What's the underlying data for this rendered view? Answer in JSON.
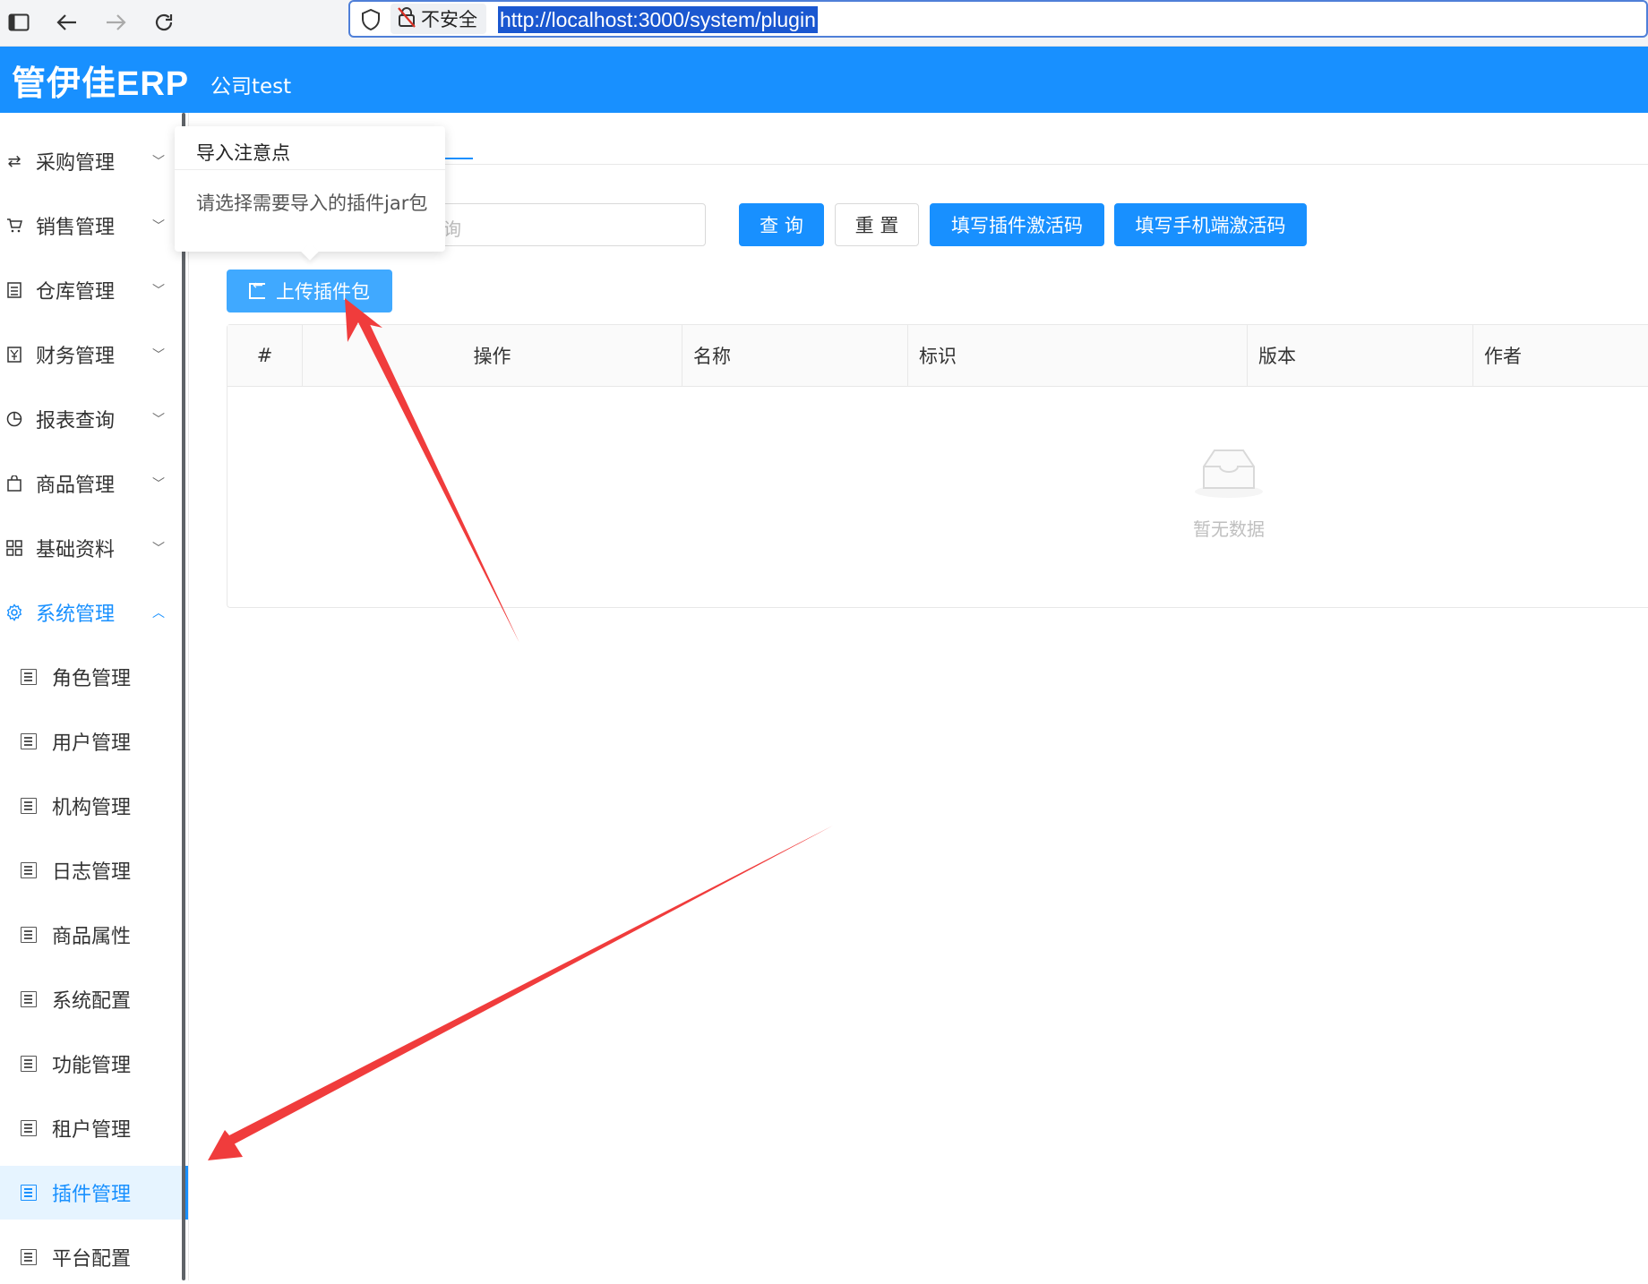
{
  "browser": {
    "security_label": "不安全",
    "url": "http://localhost:3000/system/plugin"
  },
  "header": {
    "logo": "管伊佳ERP",
    "company": "公司test"
  },
  "sidebar": {
    "menus": [
      {
        "label": "采购管理",
        "icon": "swap-icon"
      },
      {
        "label": "销售管理",
        "icon": "cart-icon"
      },
      {
        "label": "仓库管理",
        "icon": "book-icon"
      },
      {
        "label": "财务管理",
        "icon": "money-icon"
      },
      {
        "label": "报表查询",
        "icon": "pie-chart-icon"
      },
      {
        "label": "商品管理",
        "icon": "shopping-bag-icon"
      },
      {
        "label": "基础资料",
        "icon": "grid-icon"
      },
      {
        "label": "系统管理",
        "icon": "gear-icon",
        "expanded": true
      }
    ],
    "sub_items": [
      {
        "label": "角色管理"
      },
      {
        "label": "用户管理"
      },
      {
        "label": "机构管理"
      },
      {
        "label": "日志管理"
      },
      {
        "label": "商品属性"
      },
      {
        "label": "系统配置"
      },
      {
        "label": "功能管理"
      },
      {
        "label": "租户管理"
      },
      {
        "label": "插件管理",
        "selected": true
      },
      {
        "label": "平台配置"
      }
    ]
  },
  "popover": {
    "title": "导入注意点",
    "body": "请选择需要导入的插件jar包"
  },
  "search": {
    "placeholder_visible": "询"
  },
  "buttons": {
    "query": "查 询",
    "reset": "重 置",
    "plugin_activation": "填写插件激活码",
    "mobile_activation": "填写手机端激活码",
    "upload": "上传插件包"
  },
  "table": {
    "columns": [
      "#",
      "操作",
      "名称",
      "标识",
      "版本",
      "作者"
    ],
    "rows": [],
    "empty_text": "暂无数据"
  },
  "colors": {
    "primary": "#1890ff",
    "annotation_arrow": "#f03c3c"
  }
}
